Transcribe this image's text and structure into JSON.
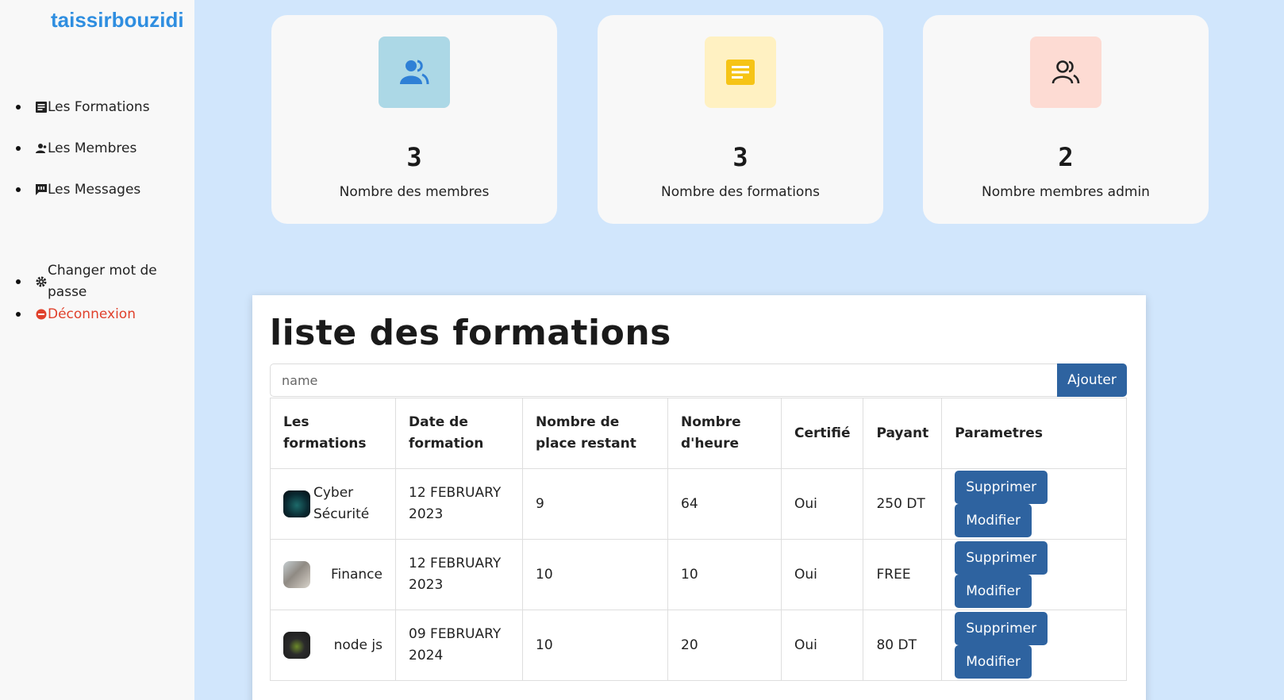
{
  "brand": "taissirbouzidi",
  "nav": {
    "formations": "Les Formations",
    "membres": "Les Membres",
    "messages": "Les Messages",
    "password": "Changer mot de passe",
    "logout": "Déconnexion"
  },
  "cards": [
    {
      "value": "3",
      "label": "Nombre des membres",
      "icon": "users-icon",
      "color": "#acd8e6"
    },
    {
      "value": "3",
      "label": "Nombre des formations",
      "icon": "note-icon",
      "color": "#fff1c2"
    },
    {
      "value": "2",
      "label": "Nombre membres admin",
      "icon": "admins-icon",
      "color": "#fddbd3"
    }
  ],
  "panel": {
    "title": "liste des formations",
    "search_placeholder": "name",
    "add_label": "Ajouter"
  },
  "table": {
    "headers": [
      "Les formations",
      "Date de formation",
      "Nombre de place restant",
      "Nombre d'heure",
      "Certifié",
      "Payant",
      "Parametres"
    ],
    "rows": [
      {
        "name": "Cyber Sécurité",
        "date": "12 FEBRUARY 2023",
        "places": "9",
        "hours": "64",
        "certified": "Oui",
        "price": "250 DT"
      },
      {
        "name": "Finance",
        "date": "12 FEBRUARY 2023",
        "places": "10",
        "hours": "10",
        "certified": "Oui",
        "price": "FREE"
      },
      {
        "name": "node js",
        "date": "09 FEBRUARY 2024",
        "places": "10",
        "hours": "20",
        "certified": "Oui",
        "price": "80 DT"
      }
    ],
    "delete_label": "Supprimer",
    "edit_label": "Modifier"
  }
}
